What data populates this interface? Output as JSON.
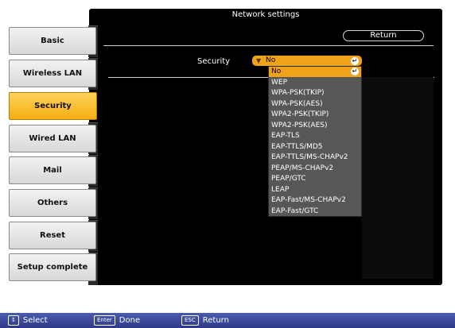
{
  "window": {
    "title": "Network settings"
  },
  "sidebar": {
    "tabs": [
      {
        "label": "Basic"
      },
      {
        "label": "Wireless LAN"
      },
      {
        "label": "Security"
      },
      {
        "label": "Wired LAN"
      },
      {
        "label": "Mail"
      },
      {
        "label": "Others"
      },
      {
        "label": "Reset"
      },
      {
        "label": "Setup complete"
      }
    ],
    "active": "Security"
  },
  "main": {
    "return_label": "Return",
    "security_label": "Security",
    "security_value": "No"
  },
  "dropdown": {
    "options": [
      {
        "label": "No"
      },
      {
        "label": "WEP"
      },
      {
        "label": "WPA-PSK(TKIP)"
      },
      {
        "label": "WPA-PSK(AES)"
      },
      {
        "label": "WPA2-PSK(TKIP)"
      },
      {
        "label": "WPA2-PSK(AES)"
      },
      {
        "label": "EAP-TLS"
      },
      {
        "label": "EAP-TTLS/MD5"
      },
      {
        "label": "EAP-TTLS/MS-CHAPv2"
      },
      {
        "label": "PEAP/MS-CHAPv2"
      },
      {
        "label": "PEAP/GTC"
      },
      {
        "label": "LEAP"
      },
      {
        "label": "EAP-Fast/MS-CHAPv2"
      },
      {
        "label": "EAP-Fast/GTC"
      }
    ]
  },
  "footer": {
    "select_label": "Select",
    "enter_key": "Enter",
    "done_label": "Done",
    "esc_key": "ESC",
    "return_label": "Return"
  },
  "colors": {
    "accent": "#f0a31a",
    "footer": "#3a4aa0",
    "panel": "#000000"
  }
}
